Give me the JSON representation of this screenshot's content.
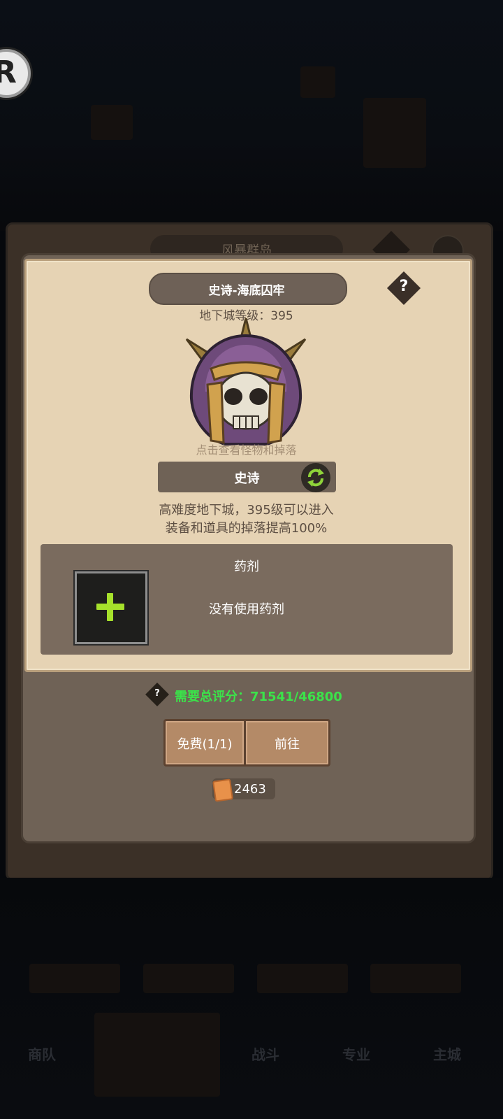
{
  "background": {
    "rank_letter": "R",
    "map_title": "风暴群岛",
    "nav_items": [
      "商队",
      "战斗",
      "专业",
      "主城"
    ]
  },
  "dialog": {
    "title": "史诗-海底囚牢",
    "help_symbol": "?",
    "dungeon_level": "地下城等级：395",
    "boss_hint": "点击查看怪物和掉落",
    "difficulty": "史诗",
    "description_line1": "高难度地下城，395级可以进入",
    "description_line2": "装备和道具的掉落提高100%",
    "potion": {
      "title": "药剂",
      "empty_text": "没有使用药剂"
    },
    "requirement_symbol": "?",
    "requirement": "需要总评分：71541/46800",
    "free_button": "免费(1/1)",
    "go_button": "前往",
    "ticket_count": "2463"
  },
  "colors": {
    "parchment": "#e6d3b4",
    "panel": "#6f6256",
    "requirement_green": "#3be34a",
    "plus_green": "#a6e12b"
  }
}
